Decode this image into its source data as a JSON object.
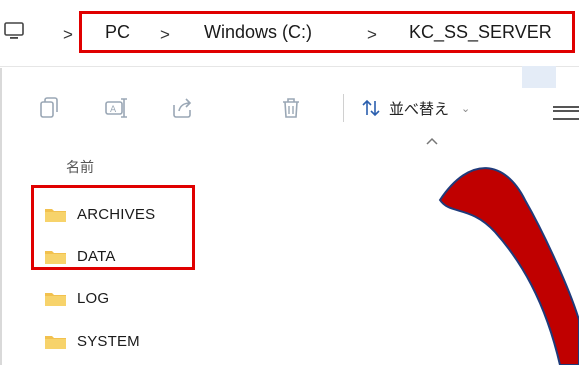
{
  "address_bar": {
    "separator": ">",
    "crumbs": [
      "PC",
      "Windows (C:)",
      "KC_SS_SERVER"
    ],
    "pc_icon": "monitor-icon"
  },
  "toolbar": {
    "icons": [
      "copy-icon",
      "rename-icon",
      "share-icon",
      "delete-icon"
    ],
    "sort_label": "並べ替え",
    "sort_icon": "sort-arrows-icon",
    "sort_chevron": "chevron-down-icon",
    "more_icon": "view-lines-icon"
  },
  "file_list": {
    "column_header": "名前",
    "folders": [
      "ARCHIVES",
      "DATA",
      "LOG",
      "SYSTEM"
    ]
  },
  "annotations": {
    "highlight_color": "#e00000",
    "arrow_fill": "#c00000",
    "arrow_outline": "#1f3a7a"
  },
  "colors": {
    "folder": "#f2c14e"
  }
}
